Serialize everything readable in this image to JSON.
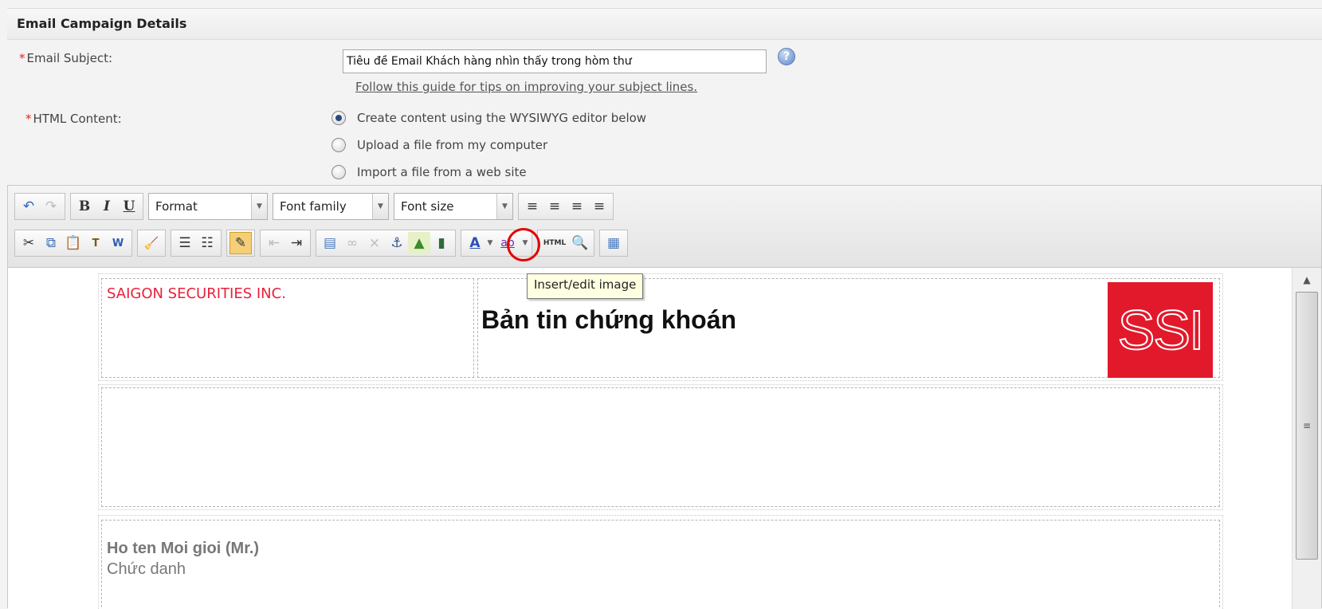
{
  "section": {
    "title": "Email Campaign Details"
  },
  "subject": {
    "required_mark": "*",
    "label": "Email Subject:",
    "value": "Tiêu đề Email Khách hàng nhìn thấy trong hòm thư",
    "help_icon": "help-icon",
    "guide_link": "Follow this guide for tips on improving your subject lines."
  },
  "html_content": {
    "required_mark": "*",
    "label": "HTML Content:",
    "options": [
      {
        "label": "Create content using the WYSIWYG editor below",
        "checked": true
      },
      {
        "label": "Upload a file from my computer",
        "checked": false
      },
      {
        "label": "Import a file from a web site",
        "checked": false
      }
    ]
  },
  "toolbar": {
    "row1": {
      "undo": "↶",
      "redo": "↷",
      "bold": "B",
      "italic": "I",
      "underline": "U",
      "format": "Format",
      "font_family": "Font family",
      "font_size": "Font size",
      "align_left": "≡",
      "align_center": "≡",
      "align_right": "≡",
      "align_justify": "≡"
    },
    "row2": {
      "cut": "✂",
      "copy": "⧉",
      "paste": "📋",
      "paste_text": "T",
      "paste_word": "W",
      "cleanup": "🧹",
      "bullet_list": "☰",
      "numbered_list": "☷",
      "edit_css": "✎",
      "outdent": "⇤",
      "indent": "⇥",
      "insert_table": "▤",
      "link": "∞",
      "unlink": "⨯",
      "anchor": "⚓",
      "image": "▲",
      "media": "▮",
      "text_color": "A",
      "highlight": "ab",
      "html_source": "HTML",
      "preview": "🔍",
      "template": "▦"
    },
    "tooltip": "Insert/edit image"
  },
  "accent_colors": {
    "highlight_ring": "#e40000",
    "required": "#e8261b",
    "brand_red": "#e2192b"
  },
  "content": {
    "company": "SAIGON SECURITIES INC.",
    "headline": "Bản tin chứng khoán",
    "logo_text": "SSI",
    "broker_name": "Ho ten Moi gioi (Mr.)",
    "broker_title": "Chức danh"
  },
  "scrollbar": {
    "up_arrow": "▲",
    "grip": "≡"
  }
}
